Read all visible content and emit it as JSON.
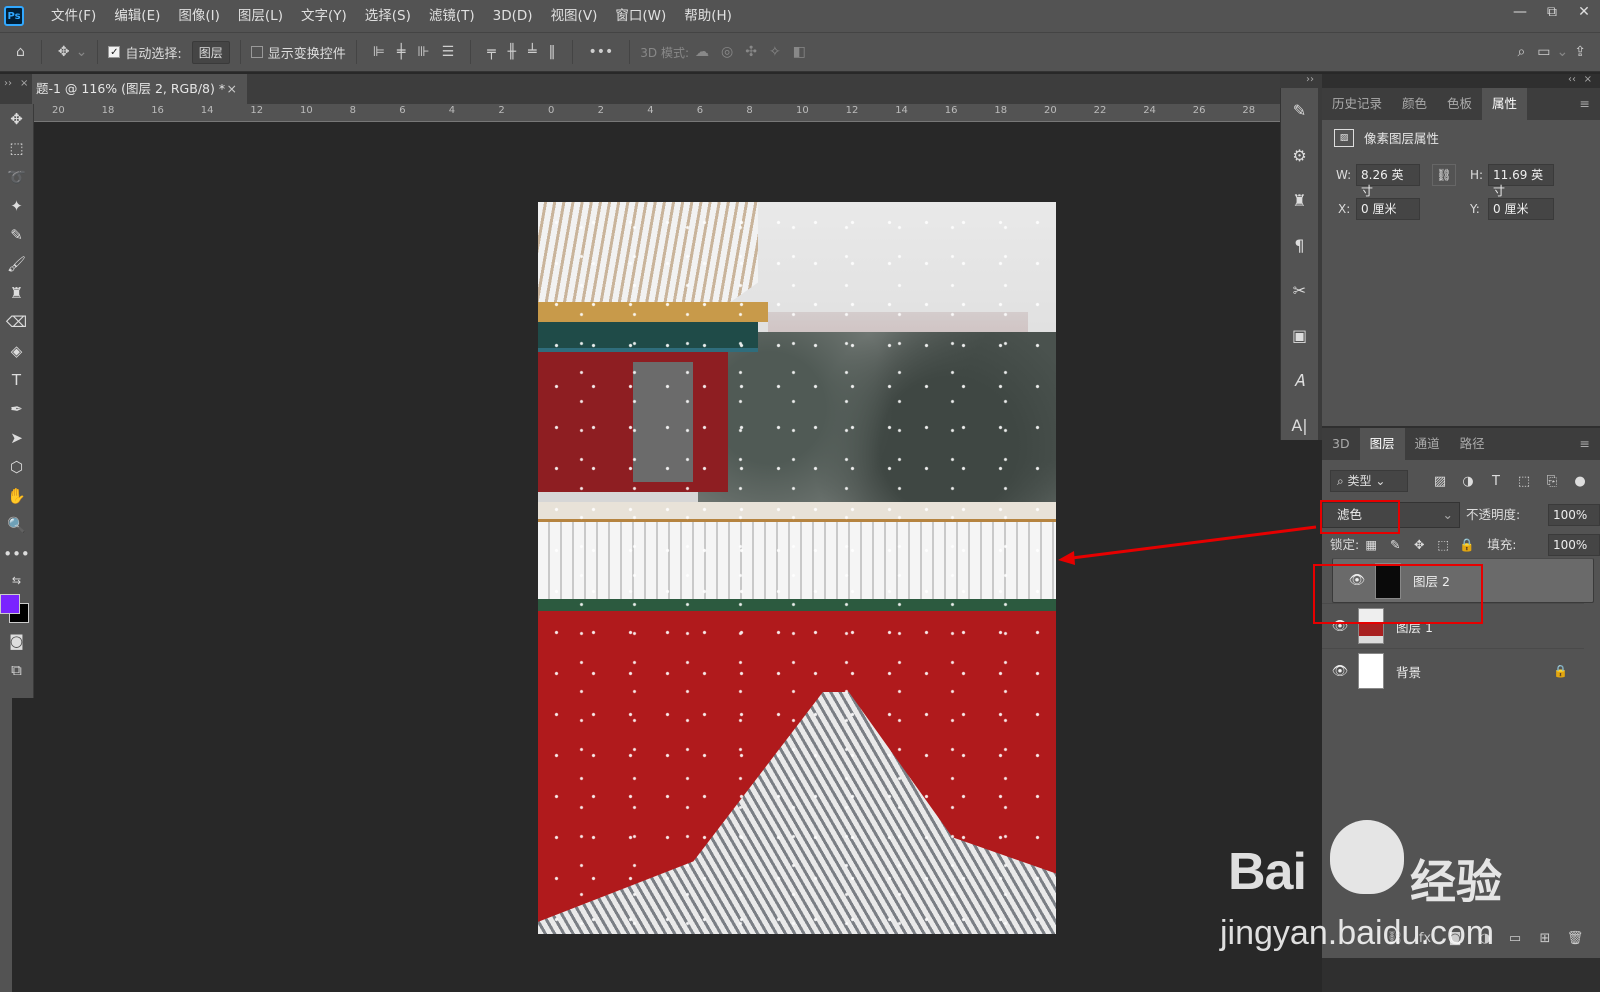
{
  "app": {
    "logo": "Ps"
  },
  "menu": [
    "文件(F)",
    "编辑(E)",
    "图像(I)",
    "图层(L)",
    "文字(Y)",
    "选择(S)",
    "滤镜(T)",
    "3D(D)",
    "视图(V)",
    "窗口(W)",
    "帮助(H)"
  ],
  "window_controls": {
    "minimize": "—",
    "restore": "⧉",
    "close": "✕"
  },
  "options": {
    "auto_select_label": "自动选择:",
    "auto_select_value": "图层",
    "show_transform_label": "显示变换控件",
    "mode_3d_label": "3D 模式:"
  },
  "document": {
    "tab_title": "题-1 @ 116% (图层 2, RGB/8) *",
    "tab_close": "×",
    "ruler_labels": [
      "20",
      "18",
      "16",
      "14",
      "12",
      "10",
      "8",
      "6",
      "4",
      "2",
      "0",
      "2",
      "4",
      "6",
      "8",
      "10",
      "12",
      "14",
      "16",
      "18",
      "20",
      "22",
      "24",
      "26",
      "28"
    ]
  },
  "panel_tabs": [
    "历史记录",
    "颜色",
    "色板",
    "属性"
  ],
  "properties": {
    "title": "像素图层属性",
    "w_label": "W:",
    "w_value": "8.26 英寸",
    "h_label": "H:",
    "h_value": "11.69 英寸",
    "x_label": "X:",
    "x_value": "0 厘米",
    "y_label": "Y:",
    "y_value": "0 厘米"
  },
  "layer_tabs": [
    "3D",
    "图层",
    "通道",
    "路径"
  ],
  "layers_panel": {
    "filter_kind": "类型",
    "blend_mode": "滤色",
    "opacity_label": "不透明度:",
    "opacity_value": "100%",
    "lock_label": "锁定:",
    "fill_label": "填充:",
    "fill_value": "100%",
    "layers": [
      {
        "name": "图层 2",
        "selected": true,
        "locked": false
      },
      {
        "name": "图层 1",
        "selected": false,
        "locked": false
      },
      {
        "name": "背景",
        "selected": false,
        "locked": true
      }
    ]
  },
  "watermark": {
    "brand": "Bai",
    "brand_cn": "经验",
    "url": "jingyan.baidu.com"
  },
  "colors": {
    "foreground": "#7a24ff",
    "background": "#000000",
    "annotation": "#e60000"
  }
}
